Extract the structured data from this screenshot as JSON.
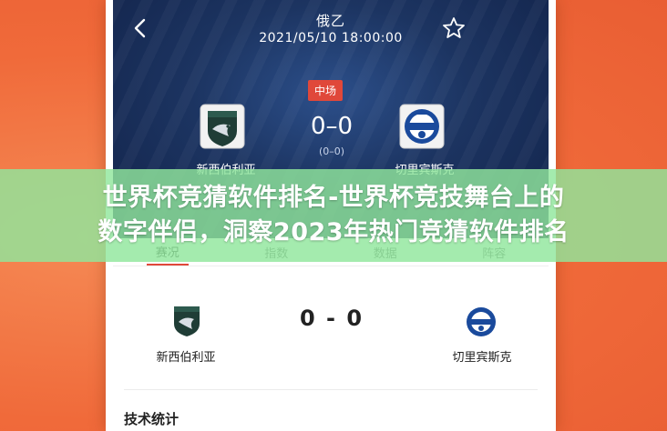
{
  "match": {
    "league": "俄乙",
    "datetime": "2021/05/10 18:00:00",
    "status": "中场",
    "score": "0–0",
    "half_score": "(0–0)",
    "home_team": "新西伯利亚",
    "away_team": "切里宾斯克",
    "score_compact": "0 - 0"
  },
  "tabs": [
    {
      "label": "赛况"
    },
    {
      "label": "指数"
    },
    {
      "label": "数据"
    },
    {
      "label": "阵容"
    }
  ],
  "stats": {
    "title": "技术统计"
  },
  "banner": {
    "line1": "世界杯竞猜软件排名-世界杯竞技舞台上的",
    "line2": "数字伴侣，洞察2023年热门竞猜软件排名"
  },
  "colors": {
    "background": "#f06a3a",
    "hero": "#1c3461",
    "status_badge": "#e0483a",
    "banner_overlay": "#90e69c"
  },
  "icons": {
    "back": "chevron-left-icon",
    "favorite": "star-outline-icon",
    "home_logo": "novosibirsk-crest-icon",
    "away_logo": "chelyabinsk-crest-icon"
  }
}
